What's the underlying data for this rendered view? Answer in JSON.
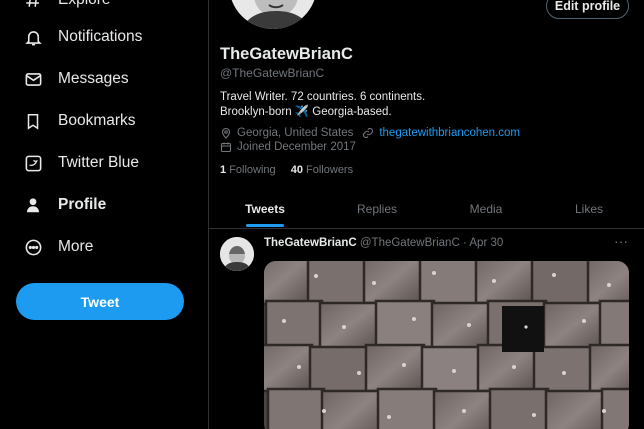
{
  "sidebar": {
    "items": [
      {
        "label": "Explore",
        "icon": "hashtag-icon"
      },
      {
        "label": "Notifications",
        "icon": "bell-icon"
      },
      {
        "label": "Messages",
        "icon": "envelope-icon"
      },
      {
        "label": "Bookmarks",
        "icon": "bookmark-icon"
      },
      {
        "label": "Twitter Blue",
        "icon": "twitter-blue-icon"
      },
      {
        "label": "Profile",
        "icon": "person-icon"
      },
      {
        "label": "More",
        "icon": "more-circle-icon"
      }
    ],
    "tweet_button": "Tweet"
  },
  "profile": {
    "edit_button": "Edit profile",
    "display_name": "TheGatewBrianC",
    "handle": "@TheGatewBrianC",
    "bio_line1": "Travel Writer. 72 countries. 6 continents.",
    "bio_line2": "Brooklyn-born ✈️ Georgia-based.",
    "location": "Georgia, United States",
    "website": "thegatewithbriancohen.com",
    "joined": "Joined December 2017",
    "following_count": "1",
    "following_label": "Following",
    "followers_count": "40",
    "followers_label": "Followers"
  },
  "tabs": [
    "Tweets",
    "Replies",
    "Media",
    "Likes"
  ],
  "tweet": {
    "name": "TheGatewBrianC",
    "handle": "@TheGatewBrianC",
    "separator": "·",
    "date": "Apr 30",
    "more": "···"
  },
  "colors": {
    "accent": "#1d9bf0",
    "background": "#000000",
    "muted": "#71767b",
    "border": "#2f3336"
  }
}
